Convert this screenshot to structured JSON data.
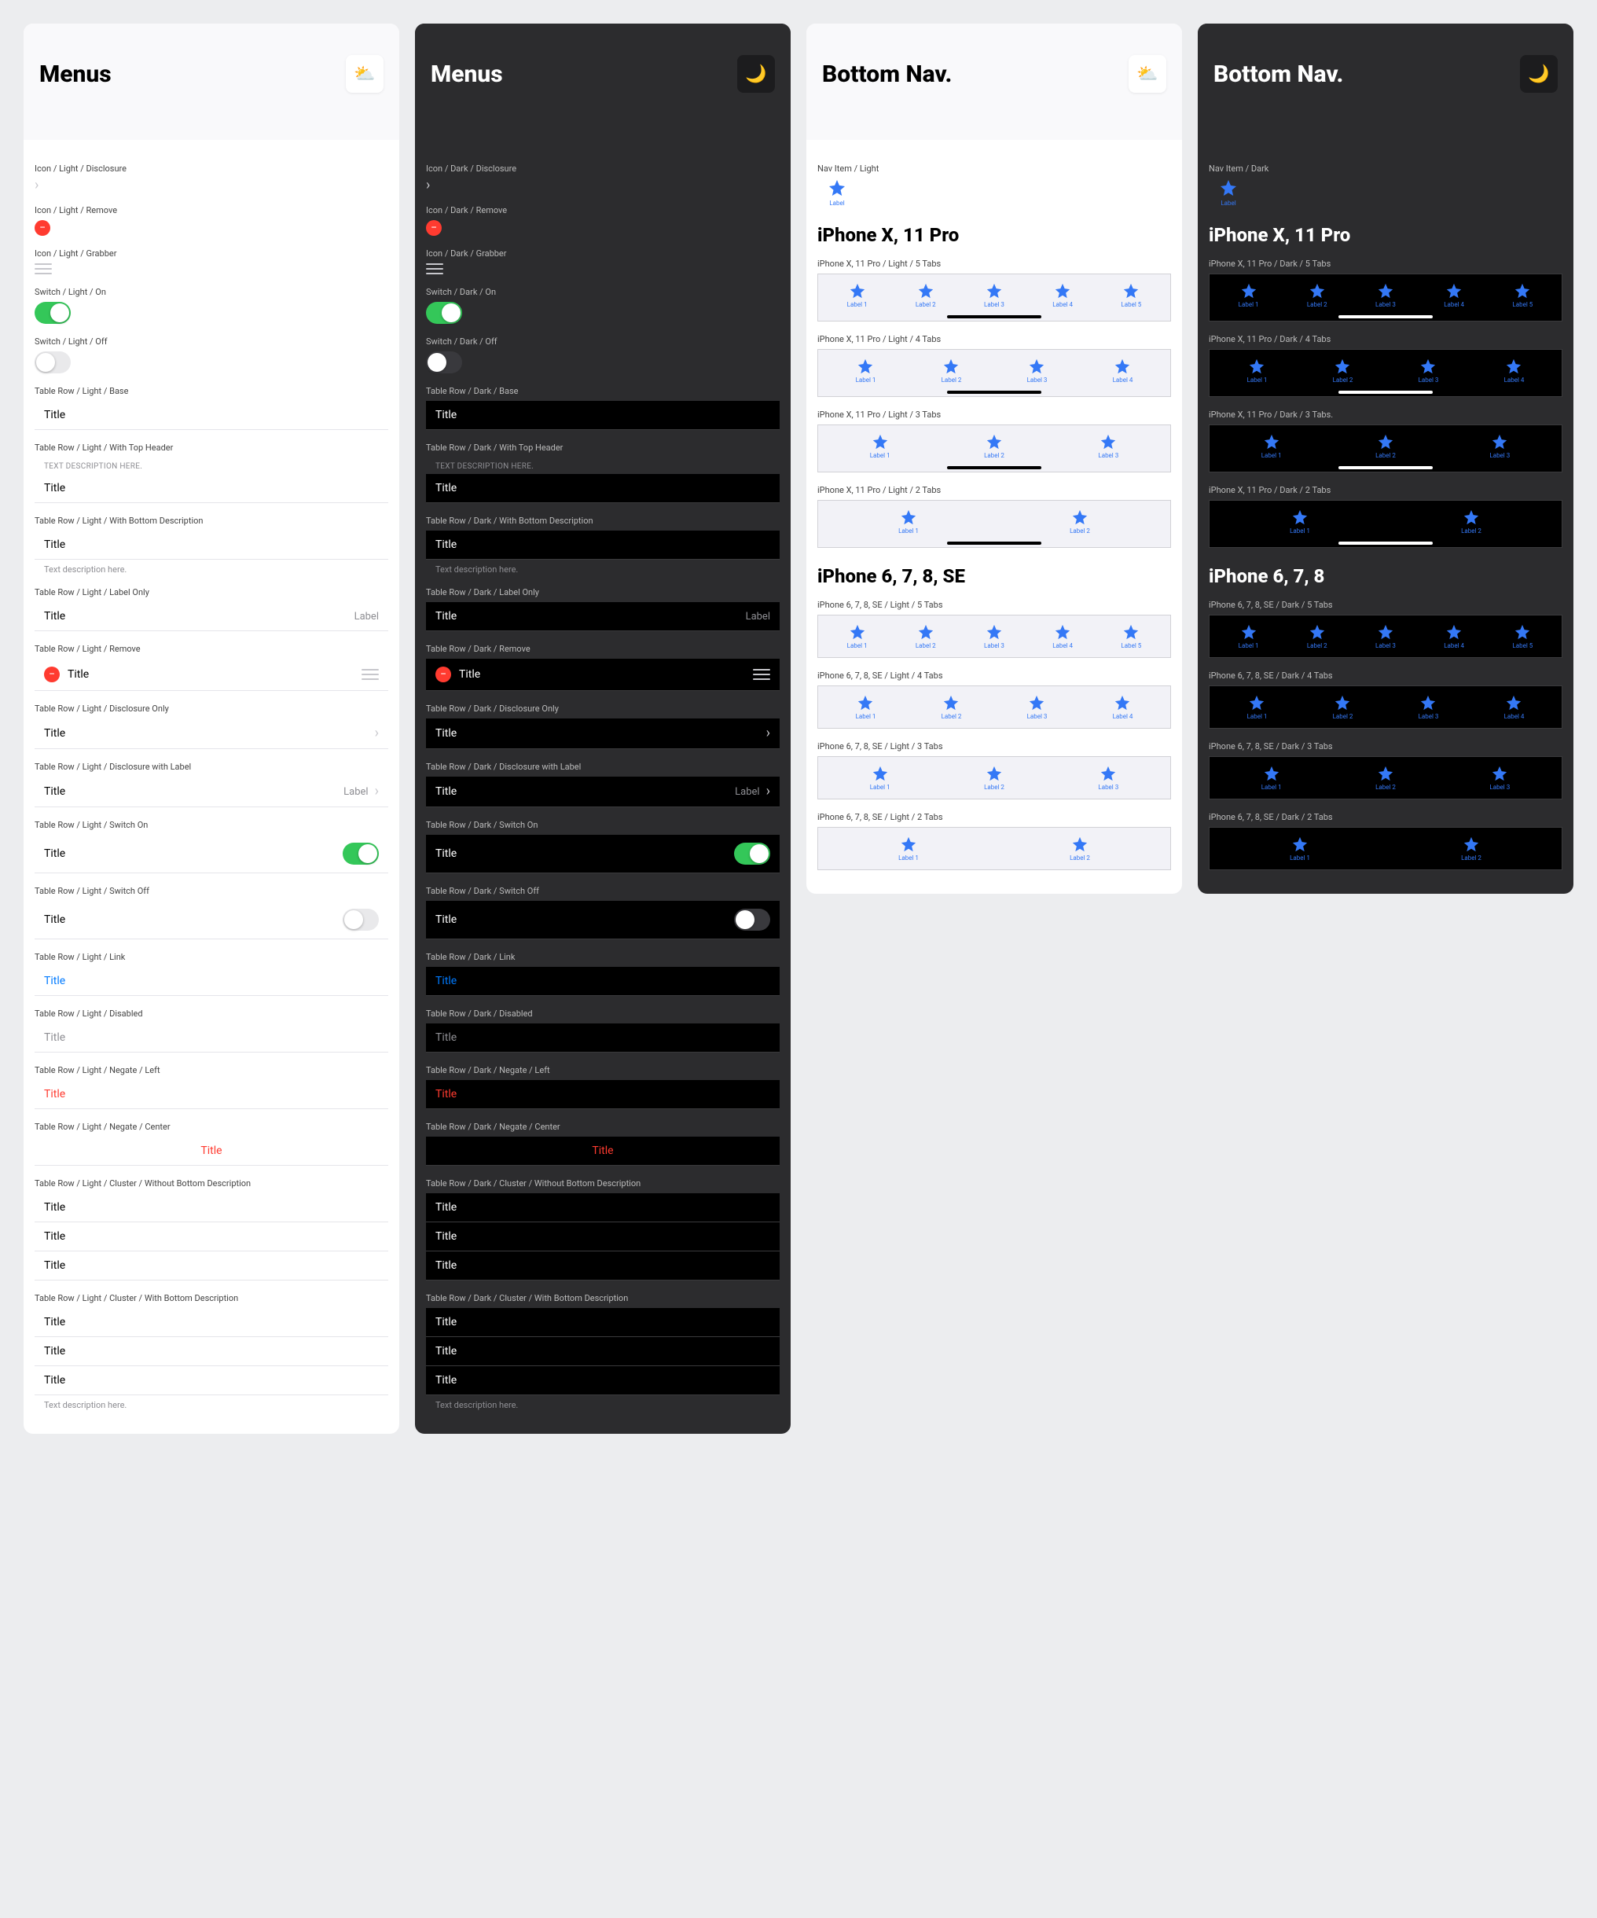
{
  "menus": {
    "title": "Menus",
    "light_badge": "⛅",
    "dark_badge": "🌙",
    "components": {
      "icon_disclosure": {
        "light_label": "Icon / Light / Disclosure",
        "dark_label": "Icon / Dark / Disclosure"
      },
      "icon_remove": {
        "light_label": "Icon / Light / Remove",
        "dark_label": "Icon / Dark / Remove"
      },
      "icon_grabber": {
        "light_label": "Icon / Light / Grabber",
        "dark_label": "Icon / Dark / Grabber"
      },
      "switch_on": {
        "light_label": "Switch / Light / On",
        "dark_label": "Switch / Dark / On"
      },
      "switch_off": {
        "light_label": "Switch / Light / Off",
        "dark_label": "Switch / Dark / Off"
      },
      "row_base": {
        "light_label": "Table Row / Light / Base",
        "dark_label": "Table Row / Dark / Base",
        "title": "Title"
      },
      "row_top_header": {
        "light_label": "Table Row / Light / With Top Header",
        "dark_label": "Table Row / Dark / With Top Header",
        "header": "TEXT DESCRIPTION HERE.",
        "title": "Title"
      },
      "row_bottom_desc": {
        "light_label": "Table Row / Light / With Bottom Description",
        "dark_label": "Table Row / Dark / With Bottom Description",
        "title": "Title",
        "footer": "Text description here."
      },
      "row_label_only": {
        "light_label": "Table Row / Light / Label Only",
        "dark_label": "Table Row / Dark / Label Only",
        "title": "Title",
        "label": "Label"
      },
      "row_remove": {
        "light_label": "Table Row / Light / Remove",
        "dark_label": "Table Row / Dark / Remove",
        "title": "Title"
      },
      "row_disclosure_only": {
        "light_label": "Table Row / Light / Disclosure Only",
        "dark_label": "Table Row / Dark / Disclosure Only",
        "title": "Title"
      },
      "row_disclosure_label": {
        "light_label": "Table Row / Light / Disclosure with Label",
        "dark_label": "Table Row / Dark / Disclosure with Label",
        "title": "Title",
        "label": "Label"
      },
      "row_switch_on": {
        "light_label": "Table Row / Light / Switch On",
        "dark_label": "Table Row / Dark / Switch On",
        "title": "Title"
      },
      "row_switch_off": {
        "light_label": "Table Row / Light / Switch Off",
        "dark_label": "Table Row / Dark / Switch Off",
        "title": "Title"
      },
      "row_link": {
        "light_label": "Table Row / Light / Link",
        "dark_label": "Table Row / Dark / Link",
        "title": "Title"
      },
      "row_disabled": {
        "light_label": "Table Row / Light / Disabled",
        "dark_label": "Table Row / Dark / Disabled",
        "title": "Title"
      },
      "row_negate_left": {
        "light_label": "Table Row / Light / Negate / Left",
        "dark_label": "Table Row / Dark / Negate / Left",
        "title": "Title"
      },
      "row_negate_center": {
        "light_label": "Table Row / Light / Negate / Center",
        "dark_label": "Table Row / Dark / Negate / Center",
        "title": "Title"
      },
      "cluster_no_desc": {
        "light_label": "Table Row / Light / Cluster / Without Bottom Description",
        "dark_label": "Table Row / Dark / Cluster / Without Bottom Description",
        "t1": "Title",
        "t2": "Title",
        "t3": "Title"
      },
      "cluster_with_desc": {
        "light_label": "Table Row / Light / Cluster / With Bottom Description",
        "dark_label": "Table Row / Dark / Cluster / With Bottom Description",
        "t1": "Title",
        "t2": "Title",
        "t3": "Title",
        "footer": "Text description here."
      }
    }
  },
  "bottomnav": {
    "title": "Bottom Nav.",
    "light_badge": "⛅",
    "dark_badge": "🌙",
    "navitem_light_label": "Nav Item / Light",
    "navitem_dark_label": "Nav Item / Dark",
    "navitem_text": "Label",
    "section_x": "iPhone X, 11 Pro",
    "section_678_light": "iPhone 6, 7, 8, SE",
    "section_678_dark": "iPhone 6, 7, 8",
    "variants_x_light": [
      {
        "label": "iPhone X, 11 Pro / Light / 5 Tabs",
        "tabs": 5,
        "indicator": true,
        "tab_labels": [
          "Label 1",
          "Label 2",
          "Label 3",
          "Label 4",
          "Label 5"
        ]
      },
      {
        "label": "iPhone X, 11 Pro / Light / 4 Tabs",
        "tabs": 4,
        "indicator": true,
        "tab_labels": [
          "Label 1",
          "Label 2",
          "Label 3",
          "Label 4"
        ]
      },
      {
        "label": "iPhone X, 11 Pro / Light / 3 Tabs",
        "tabs": 3,
        "indicator": true,
        "tab_labels": [
          "Label 1",
          "Label 2",
          "Label 3"
        ]
      },
      {
        "label": "iPhone X, 11 Pro / Light / 2 Tabs",
        "tabs": 2,
        "indicator": true,
        "tab_labels": [
          "Label 1",
          "Label 2"
        ]
      }
    ],
    "variants_x_dark": [
      {
        "label": "iPhone X, 11 Pro / Dark / 5 Tabs",
        "tabs": 5,
        "indicator": true,
        "tab_labels": [
          "Label 1",
          "Label 2",
          "Label 3",
          "Label 4",
          "Label 5"
        ]
      },
      {
        "label": "iPhone X, 11 Pro / Dark / 4 Tabs",
        "tabs": 4,
        "indicator": true,
        "tab_labels": [
          "Label 1",
          "Label 2",
          "Label 3",
          "Label 4"
        ]
      },
      {
        "label": "iPhone X, 11 Pro / Dark / 3 Tabs.",
        "tabs": 3,
        "indicator": true,
        "tab_labels": [
          "Label 1",
          "Label 2",
          "Label 3"
        ]
      },
      {
        "label": "iPhone X, 11 Pro / Dark / 2 Tabs",
        "tabs": 2,
        "indicator": true,
        "tab_labels": [
          "Label 1",
          "Label 2"
        ]
      }
    ],
    "variants_678_light": [
      {
        "label": "iPhone 6, 7, 8, SE / Light / 5 Tabs",
        "tabs": 5,
        "indicator": false,
        "tab_labels": [
          "Label 1",
          "Label 2",
          "Label 3",
          "Label 4",
          "Label 5"
        ]
      },
      {
        "label": "iPhone 6, 7, 8, SE / Light / 4 Tabs",
        "tabs": 4,
        "indicator": false,
        "tab_labels": [
          "Label 1",
          "Label 2",
          "Label 3",
          "Label 4"
        ]
      },
      {
        "label": "iPhone 6, 7, 8, SE / Light / 3 Tabs",
        "tabs": 3,
        "indicator": false,
        "tab_labels": [
          "Label 1",
          "Label 2",
          "Label 3"
        ]
      },
      {
        "label": "iPhone 6, 7, 8, SE / Light / 2 Tabs",
        "tabs": 2,
        "indicator": false,
        "tab_labels": [
          "Label 1",
          "Label 2"
        ]
      }
    ],
    "variants_678_dark": [
      {
        "label": "iPhone 6, 7, 8, SE / Dark / 5 Tabs",
        "tabs": 5,
        "indicator": false,
        "tab_labels": [
          "Label 1",
          "Label 2",
          "Label 3",
          "Label 4",
          "Label 5"
        ]
      },
      {
        "label": "iPhone 6, 7, 8, SE / Dark / 4 Tabs",
        "tabs": 4,
        "indicator": false,
        "tab_labels": [
          "Label 1",
          "Label 2",
          "Label 3",
          "Label 4"
        ]
      },
      {
        "label": "iPhone 6, 7, 8, SE / Dark / 3 Tabs",
        "tabs": 3,
        "indicator": false,
        "tab_labels": [
          "Label 1",
          "Label 2",
          "Label 3"
        ]
      },
      {
        "label": "iPhone 6, 7, 8, SE / Dark / 2 Tabs",
        "tabs": 2,
        "indicator": false,
        "tab_labels": [
          "Label 1",
          "Label 2"
        ]
      }
    ]
  }
}
